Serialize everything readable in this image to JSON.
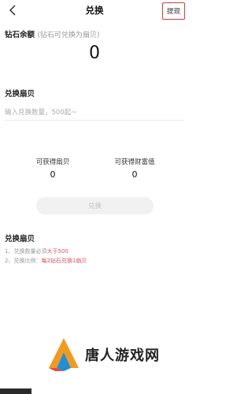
{
  "header": {
    "title": "兑换",
    "withdraw_label": "提现"
  },
  "balance": {
    "label": "钻石余额",
    "hint": "(钻石可兑换为扇贝)",
    "value": "0"
  },
  "exchange": {
    "label": "兑换扇贝",
    "input_placeholder": "输入兑换数量，500起~",
    "input_value": ""
  },
  "stats": {
    "shells_label": "可获得扇贝",
    "shells_value": "0",
    "wealth_label": "可获得财富值",
    "wealth_value": "0"
  },
  "submit_label": "兑换",
  "rules": {
    "title": "兑换扇贝",
    "line1_prefix": "1、兑换数量必须",
    "line1_highlight": "大于500",
    "line2_prefix": "2、兑换比例：",
    "line2_highlight": "每2钻石兑换1扇贝"
  },
  "watermark": {
    "text": "唐人游戏网"
  },
  "colors": {
    "accent_red": "#e4505f",
    "border_red": "#d93a3a",
    "disabled_button_bg": "#f1f1f1"
  },
  "icons": {
    "back": "back-arrow-icon"
  }
}
